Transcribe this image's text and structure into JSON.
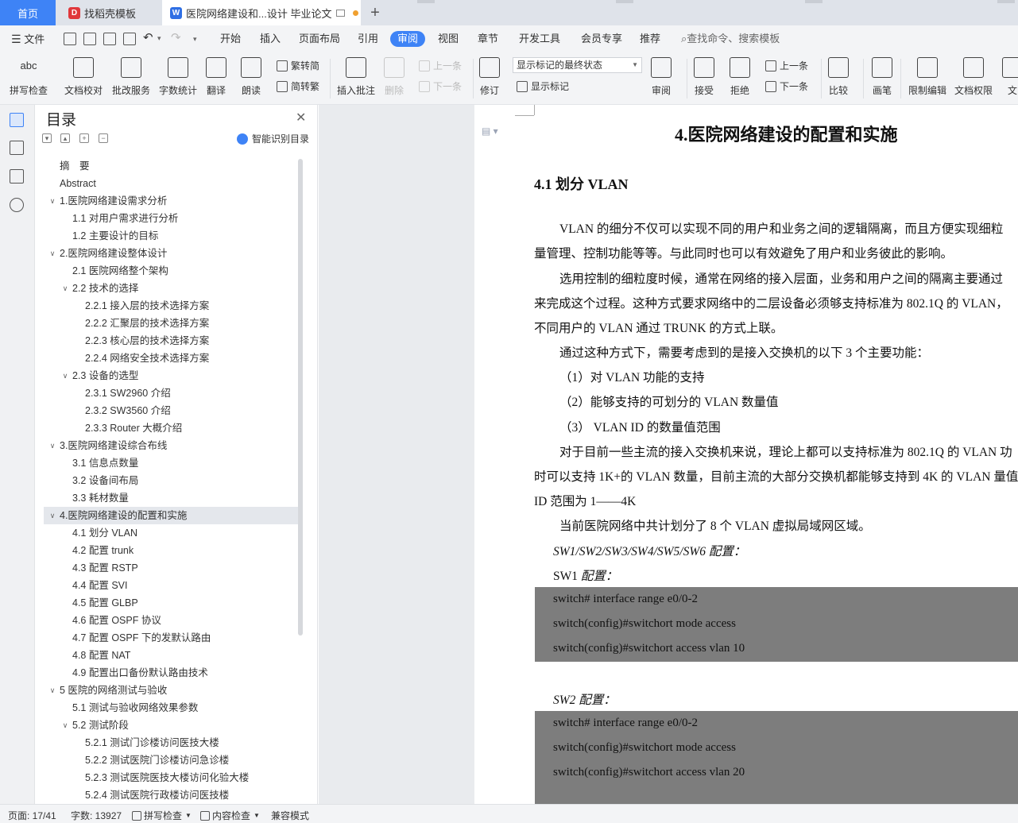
{
  "tabs": {
    "home": "首页",
    "templates": "找稻壳模板",
    "document": "医院网络建设和...设计 毕业论文",
    "add": "+"
  },
  "menu": {
    "file": "文件",
    "items": [
      "开始",
      "插入",
      "页面布局",
      "引用",
      "审阅",
      "视图",
      "章节",
      "开发工具",
      "会员专享",
      "推荐"
    ],
    "active": "审阅",
    "search": "查找命令、搜索模板"
  },
  "ribbon": {
    "spell_check": "拼写检查",
    "doc_check": "文档校对",
    "batch_service": "批改服务",
    "word_count": "字数统计",
    "translate": "翻译",
    "read_aloud": "朗读",
    "to_traditional": "繁转简",
    "to_simplified": "简转繁",
    "insert_comment": "插入批注",
    "delete": "删除",
    "prev_comment": "上一条",
    "next_comment": "下一条",
    "revise": "修订",
    "markup_mode": "显示标记的最终状态",
    "show_markup": "显示标记",
    "review": "审阅",
    "accept": "接受",
    "reject": "拒绝",
    "prev_change": "上一条",
    "next_change": "下一条",
    "compare": "比较",
    "pen": "画笔",
    "restrict_edit": "限制编辑",
    "doc_permission": "文档权限",
    "doc_cut": "文"
  },
  "toc": {
    "title": "目录",
    "smart": "智能识别目录",
    "items": [
      {
        "label": "摘　要",
        "level": 0,
        "caret": false
      },
      {
        "label": "Abstract",
        "level": 0,
        "caret": false
      },
      {
        "label": "1.医院网络建设需求分析",
        "level": 0,
        "caret": true
      },
      {
        "label": "1.1 对用户需求进行分析",
        "level": 1,
        "caret": false
      },
      {
        "label": "1.2 主要设计的目标",
        "level": 1,
        "caret": false
      },
      {
        "label": "2.医院网络建设整体设计",
        "level": 0,
        "caret": true
      },
      {
        "label": "2.1 医院网络整个架构",
        "level": 1,
        "caret": false
      },
      {
        "label": "2.2 技术的选择",
        "level": 1,
        "caret": true
      },
      {
        "label": "2.2.1  接入层的技术选择方案",
        "level": 2,
        "caret": false
      },
      {
        "label": "2.2.2  汇聚层的技术选择方案",
        "level": 2,
        "caret": false
      },
      {
        "label": "2.2.3  核心层的技术选择方案",
        "level": 2,
        "caret": false
      },
      {
        "label": "2.2.4 网络安全技术选择方案",
        "level": 2,
        "caret": false
      },
      {
        "label": "2.3 设备的选型",
        "level": 1,
        "caret": true
      },
      {
        "label": "2.3.1 SW2960 介绍",
        "level": 2,
        "caret": false
      },
      {
        "label": "2.3.2 SW3560 介绍",
        "level": 2,
        "caret": false
      },
      {
        "label": "2.3.3 Router 大概介绍",
        "level": 2,
        "caret": false
      },
      {
        "label": "3.医院网络建设综合布线",
        "level": 0,
        "caret": true
      },
      {
        "label": "3.1  信息点数量",
        "level": 1,
        "caret": false
      },
      {
        "label": "3.2  设备间布局",
        "level": 1,
        "caret": false
      },
      {
        "label": "3.3  耗材数量",
        "level": 1,
        "caret": false
      },
      {
        "label": "4.医院网络建设的配置和实施",
        "level": 0,
        "caret": true,
        "selected": true
      },
      {
        "label": "4.1  划分 VLAN",
        "level": 1,
        "caret": false
      },
      {
        "label": "4.2  配置 trunk",
        "level": 1,
        "caret": false
      },
      {
        "label": "4.3  配置 RSTP",
        "level": 1,
        "caret": false
      },
      {
        "label": "4.4  配置 SVI",
        "level": 1,
        "caret": false
      },
      {
        "label": "4.5  配置 GLBP",
        "level": 1,
        "caret": false
      },
      {
        "label": "4.6  配置 OSPF 协议",
        "level": 1,
        "caret": false
      },
      {
        "label": "4.7 配置 OSPF 下的发默认路由",
        "level": 1,
        "caret": false
      },
      {
        "label": "4.8 配置 NAT",
        "level": 1,
        "caret": false
      },
      {
        "label": "4.9 配置出口备份默认路由技术",
        "level": 1,
        "caret": false
      },
      {
        "label": "5 医院的网络测试与验收",
        "level": 0,
        "caret": true
      },
      {
        "label": "5.1 测试与验收网络效果参数",
        "level": 1,
        "caret": false
      },
      {
        "label": "5.2 测试阶段",
        "level": 1,
        "caret": true
      },
      {
        "label": "5.2.1 测试门诊楼访问医技大楼",
        "level": 2,
        "caret": false
      },
      {
        "label": "5.2.2 测试医院门诊楼访问急诊楼",
        "level": 2,
        "caret": false
      },
      {
        "label": "5.2.3 测试医院医技大楼访问化验大楼",
        "level": 2,
        "caret": false
      },
      {
        "label": "5.2.4 测试医院行政楼访问医技楼",
        "level": 2,
        "caret": false
      }
    ]
  },
  "doc": {
    "heading": "4.医院网络建设的配置和实施",
    "subheading": "4.1  划分 VLAN",
    "p1a": "VLAN 的细分不仅可以实现不同的用户和业务之间的逻辑隔离，而且方便实现细粒",
    "p1b": "量管理、控制功能等等。与此同时也可以有效避免了用户和业务彼此的影响。",
    "p2a": "选用控制的细粒度时候，通常在网络的接入层面，业务和用户之间的隔离主要通过",
    "p2b": "来完成这个过程。这种方式要求网络中的二层设备必须够支持标准为 802.1Q 的 VLAN，",
    "p2c": "不同用户的 VLAN 通过 TRUNK 的方式上联。",
    "p3": "通过这种方式下，需要考虑到的是接入交换机的以下 3 个主要功能：",
    "l1": "（1）对  VLAN 功能的支持",
    "l2": "（2）能够支持的可划分的 VLAN 数量值",
    "l3": "（3）  VLAN ID 的数量值范围",
    "p4a": "对于目前一些主流的接入交换机来说，理论上都可以支持标准为 802.1Q 的 VLAN 功",
    "p4b": "时可以支持 1K+的 VLAN 数量，目前主流的大部分交换机都能够支持到 4K 的 VLAN 量值",
    "p4c": "ID 范围为 1——4K",
    "p5": "当前医院网络中共计划分了 8 个 VLAN 虚拟局域网区域。",
    "cfg_all": "SW1/SW2/SW3/SW4/SW5/SW6 配置：",
    "sw1_prefix": "SW1 ",
    "sw1_suffix": "配置：",
    "code1": [
      "switch# interface range e0/0-2",
      "switch(config)#switchort mode access",
      "switch(config)#switchort access vlan 10"
    ],
    "sw2": "SW2 配置：",
    "code2": [
      "switch# interface range e0/0-2",
      "switch(config)#switchort mode access",
      "switch(config)#switchort access vlan 20"
    ]
  },
  "status": {
    "page": "页面: 17/41",
    "words": "字数: 13927",
    "spell": "拼写检查",
    "content": "内容检查",
    "compat": "兼容模式"
  },
  "colors": {
    "accent": "#3e83f6",
    "code_bg": "#7d7d7d"
  }
}
